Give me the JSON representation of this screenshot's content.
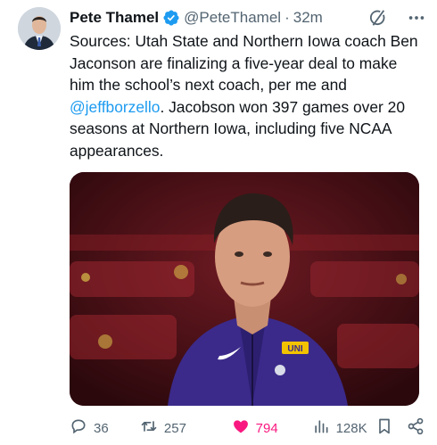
{
  "author": {
    "name": "Pete Thamel",
    "handle": "@PeteThamel",
    "separator": "·",
    "time": "32m"
  },
  "tweet": {
    "text_before": "Sources: Utah State and Northern Iowa coach Ben Jaconson are finalizing a five-year deal to make him the school’s next coach, per me and ",
    "mention": "@jeffborzello",
    "text_after": ". Jacobson won 397 games over 20 seasons at Northern Iowa, including five NCAA appearances."
  },
  "media": {
    "logo_text": "UNI"
  },
  "actions": {
    "replies": "36",
    "reposts": "257",
    "likes": "794",
    "views": "128K"
  },
  "colors": {
    "accent": "#1d9bf0",
    "like": "#f91880",
    "muted": "#536471",
    "verified": "#1d9bf0"
  },
  "icons": [
    "verified-badge-icon",
    "grok-icon",
    "more-icon",
    "reply-icon",
    "repost-icon",
    "like-icon",
    "views-icon",
    "bookmark-icon",
    "share-icon"
  ]
}
